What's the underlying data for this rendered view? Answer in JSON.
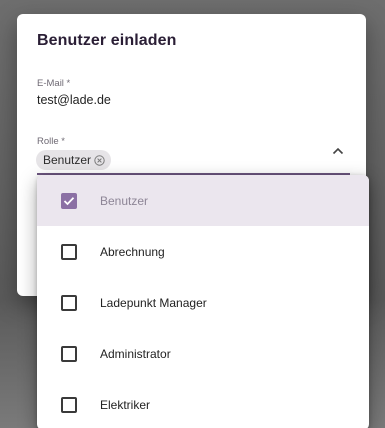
{
  "dialog": {
    "title": "Benutzer einladen"
  },
  "email": {
    "label": "E-Mail *",
    "value": "test@lade.de"
  },
  "role": {
    "label": "Rolle *",
    "selected_chip": "Benutzer",
    "chip_remove_icon": "circle-x-icon",
    "expand_icon": "chevron-up-icon"
  },
  "role_options": [
    {
      "label": "Benutzer",
      "checked": true
    },
    {
      "label": "Abrechnung",
      "checked": false
    },
    {
      "label": "Ladepunkt Manager",
      "checked": false
    },
    {
      "label": "Administrator",
      "checked": false
    },
    {
      "label": "Elektriker",
      "checked": false
    }
  ],
  "colors": {
    "accent": "#8b70a4",
    "underline": "#6d5680",
    "selected_row": "#ebe6ee",
    "title": "#2a1e35"
  }
}
